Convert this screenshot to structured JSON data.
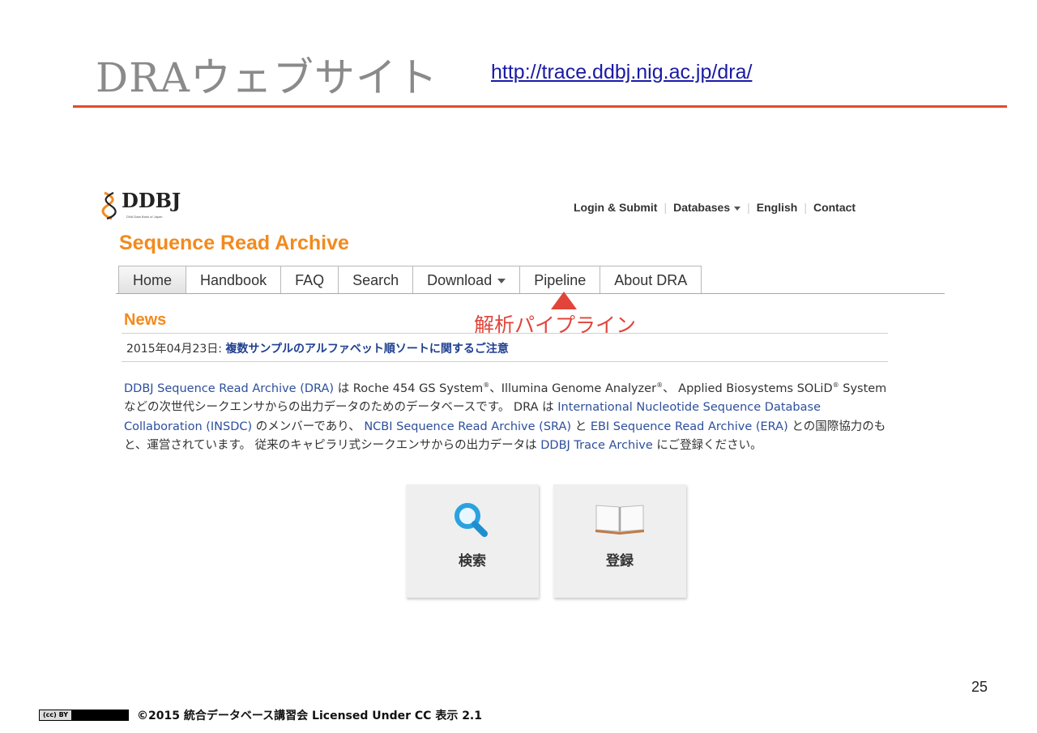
{
  "slide": {
    "title": "DRAウェブサイト",
    "url": "http://trace.ddbj.nig.ac.jp/dra/",
    "accent_color": "#e24a2b",
    "page_number": "25",
    "footer_license_badge": "(cc) BY",
    "footer_text": "©2015 統合データベース講習会 Licensed Under CC 表示 2.1"
  },
  "site": {
    "logo_text": "DDBJ",
    "logo_subtext": "DNA Data Bank of Japan",
    "title": "Sequence Read Archive",
    "brand_color": "#f28a1e",
    "top_nav": {
      "login": "Login & Submit",
      "databases": "Databases",
      "english": "English",
      "contact": "Contact"
    },
    "tabs": [
      {
        "label": "Home",
        "active": true
      },
      {
        "label": "Handbook"
      },
      {
        "label": "FAQ"
      },
      {
        "label": "Search"
      },
      {
        "label": "Download"
      },
      {
        "label": "Pipeline"
      },
      {
        "label": "About DRA"
      }
    ],
    "annotation": "解析パイプライン",
    "news": {
      "heading": "News",
      "date": "2015年04月23日: ",
      "headline": "複数サンプルのアルファベット順ソートに関するご注意"
    },
    "description": {
      "l1_link1": "DDBJ Sequence Read Archive (DRA)",
      "l1_text": " は Roche 454 GS System",
      "l1_text2": "、Illumina Genome Analyzer",
      "l1_text3": "、 Applied Biosystems SOLiD",
      "l1_text4": " System",
      "reg": "®",
      "l2_text": "などの次世代シークエンサからの出力データのためのデータベースです。 DRA は ",
      "l2_link": "International Nucleotide Sequence Database",
      "l3_link": "Collaboration (INSDC)",
      "l3_text": " のメンバーであり、 ",
      "l3_link2": "NCBI Sequence Read Archive (SRA)",
      "l3_text2": " と ",
      "l3_link3": "EBI Sequence Read Archive (ERA)",
      "l3_text3": " との国際協力のも",
      "l4_text": "と、運営されています。 従来のキャピラリ式シークエンサからの出力データは ",
      "l4_link": "DDBJ Trace Archive",
      "l4_text2": " にご登録ください。"
    },
    "cards": [
      {
        "label": "検索",
        "icon": "magnifier-icon"
      },
      {
        "label": "登録",
        "icon": "open-book-icon"
      }
    ]
  }
}
